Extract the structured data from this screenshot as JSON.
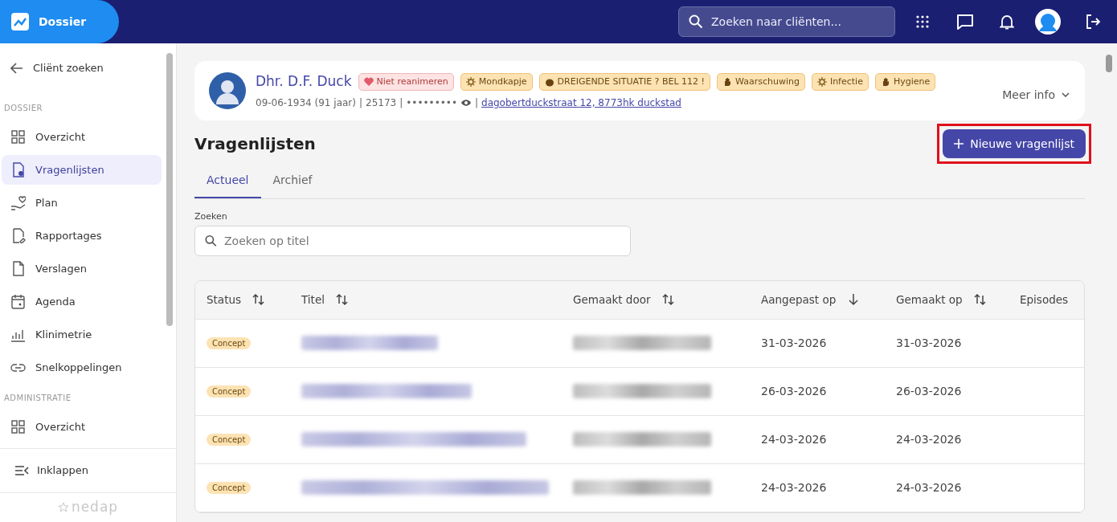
{
  "app": {
    "title": "Dossier",
    "search_placeholder": "Zoeken naar cliënten..."
  },
  "sidebar": {
    "back": "Cliënt zoeken",
    "sections": [
      {
        "heading": "DOSSIER",
        "items": [
          {
            "label": "Overzicht",
            "selected": false
          },
          {
            "label": "Vragenlijsten",
            "selected": true
          },
          {
            "label": "Plan",
            "selected": false
          },
          {
            "label": "Rapportages",
            "selected": false
          },
          {
            "label": "Verslagen",
            "selected": false
          },
          {
            "label": "Agenda",
            "selected": false
          },
          {
            "label": "Klinimetrie",
            "selected": false
          },
          {
            "label": "Snelkoppelingen",
            "selected": false
          }
        ]
      },
      {
        "heading": "ADMINISTRATIE",
        "items": [
          {
            "label": "Overzicht",
            "selected": false
          }
        ]
      }
    ],
    "collapse": "Inklappen",
    "brand": "nedap"
  },
  "client": {
    "name": "Dhr. D.F. Duck",
    "meta": [
      {
        "kind": "text",
        "text": "09-06-1934 (91 jaar)"
      },
      {
        "kind": "separator",
        "text": "|"
      },
      {
        "kind": "text",
        "text": "25173"
      },
      {
        "kind": "separator",
        "text": "|"
      },
      {
        "kind": "masked",
        "text": "•••••••••"
      },
      {
        "kind": "separator",
        "text": "|"
      },
      {
        "kind": "link",
        "text": "dagobertduckstraat 12, 8773hk duckstad"
      }
    ],
    "badges": [
      {
        "label": "Niet reanimeren",
        "kind": "danger"
      },
      {
        "label": "Mondkapje",
        "kind": "warning"
      },
      {
        "label": "DREIGENDE SITUATIE ? BEL 112 !",
        "kind": "warning"
      },
      {
        "label": "Waarschuwing",
        "kind": "warning"
      },
      {
        "label": "Infectie",
        "kind": "warning"
      },
      {
        "label": "Hygiene",
        "kind": "warning"
      }
    ],
    "more": "Meer info"
  },
  "page": {
    "title": "Vragenlijsten",
    "new_button": {
      "label": "Nieuwe vragenlijst",
      "highlighted": true
    },
    "tabs": [
      {
        "label": "Actueel",
        "selected": true
      },
      {
        "label": "Archief",
        "selected": false
      }
    ],
    "search": {
      "label": "Zoeken",
      "placeholder": "Zoeken op titel"
    }
  },
  "table": {
    "columns": [
      {
        "label": "Status",
        "kind": "sortable"
      },
      {
        "label": "Titel",
        "kind": "sortable"
      },
      {
        "label": "Gemaakt door",
        "kind": "sortable"
      },
      {
        "label": "Aangepast op",
        "kind": "descending"
      },
      {
        "label": "Gemaakt op",
        "kind": "sortable"
      },
      {
        "label": "Episodes",
        "kind": "plain"
      }
    ],
    "rows": [
      {
        "status": "Concept",
        "title_redacted": true,
        "author_redacted": true,
        "modified": "31-03-2026",
        "created": "31-03-2026"
      },
      {
        "status": "Concept",
        "title_redacted": true,
        "author_redacted": true,
        "modified": "26-03-2026",
        "created": "26-03-2026"
      },
      {
        "status": "Concept",
        "title_redacted": true,
        "author_redacted": true,
        "modified": "24-03-2026",
        "created": "24-03-2026"
      },
      {
        "status": "Concept",
        "title_redacted": true,
        "author_redacted": true,
        "modified": "24-03-2026",
        "created": "24-03-2026"
      }
    ]
  }
}
